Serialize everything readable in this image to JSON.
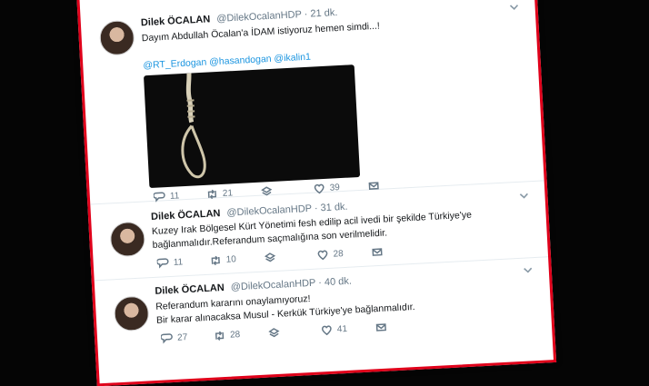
{
  "tweets": [
    {
      "name": "Dilek ÖCALAN",
      "handle": "@DilekOcalanHDP",
      "time": "· 21 dk.",
      "text": "Dayım Abdullah Öcalan'a İDAM istiyoruz hemen simdi...!",
      "mentions": "@RT_Erdogan @hasandogan @ikalin1",
      "replies": "11",
      "retweets": "21",
      "likes": "39"
    },
    {
      "name": "Dilek ÖCALAN",
      "handle": "@DilekOcalanHDP",
      "time": "· 31 dk.",
      "text_line1": "Kuzey Irak Bölgesel Kürt Yönetimi fesh edilip acil ivedi bir şekilde Türkiye'ye",
      "text_line2": "bağlanmalıdır.Referandum saçmalığına son verilmelidir.",
      "replies": "11",
      "retweets": "10",
      "likes": "28"
    },
    {
      "name": "Dilek ÖCALAN",
      "handle": "@DilekOcalanHDP",
      "time": "· 40 dk.",
      "text_line1": "Referandum kararını onaylamıyoruz!",
      "text_line2": "Bir karar alınacaksa Musul - Kerkük Türkiye'ye bağlanmalıdır.",
      "replies": "27",
      "retweets": "28",
      "likes": "41"
    }
  ]
}
